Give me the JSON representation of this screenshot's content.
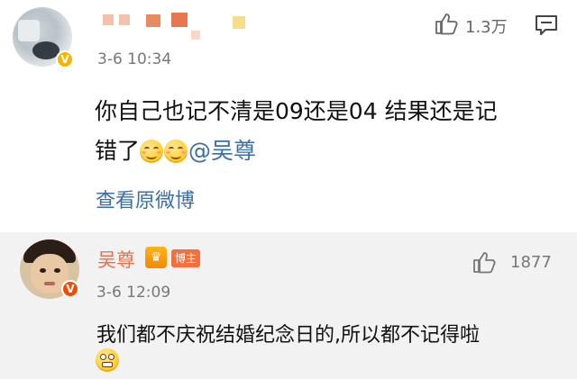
{
  "comment": {
    "time": "3-6 10:34",
    "like_count": "1.3万",
    "text_line1": "你自己也记不清是09还是04 结果还是记",
    "text_line2_prefix": "错了",
    "mention": "@吴尊",
    "view_original": "查看原微博",
    "verified_badge": "V",
    "colors": {
      "link": "#3b6ea5",
      "badge": "#f4b400"
    }
  },
  "reply": {
    "author": "吴尊",
    "crown_badge": "♛",
    "blogger_tag": "博主",
    "time": "3-6 12:09",
    "like_count": "1877",
    "text": "我们都不庆祝结婚纪念日的,所以都不记得啦",
    "verified_badge": "V",
    "colors": {
      "name": "#e8704b",
      "tag": "#f36f3b",
      "background": "#f2f2f2"
    }
  },
  "icons": {
    "like": "thumbs-up-icon",
    "reply": "comment-icon",
    "emoji_smile": "grin-emoji",
    "emoji_awkward": "awkward-emoji"
  }
}
